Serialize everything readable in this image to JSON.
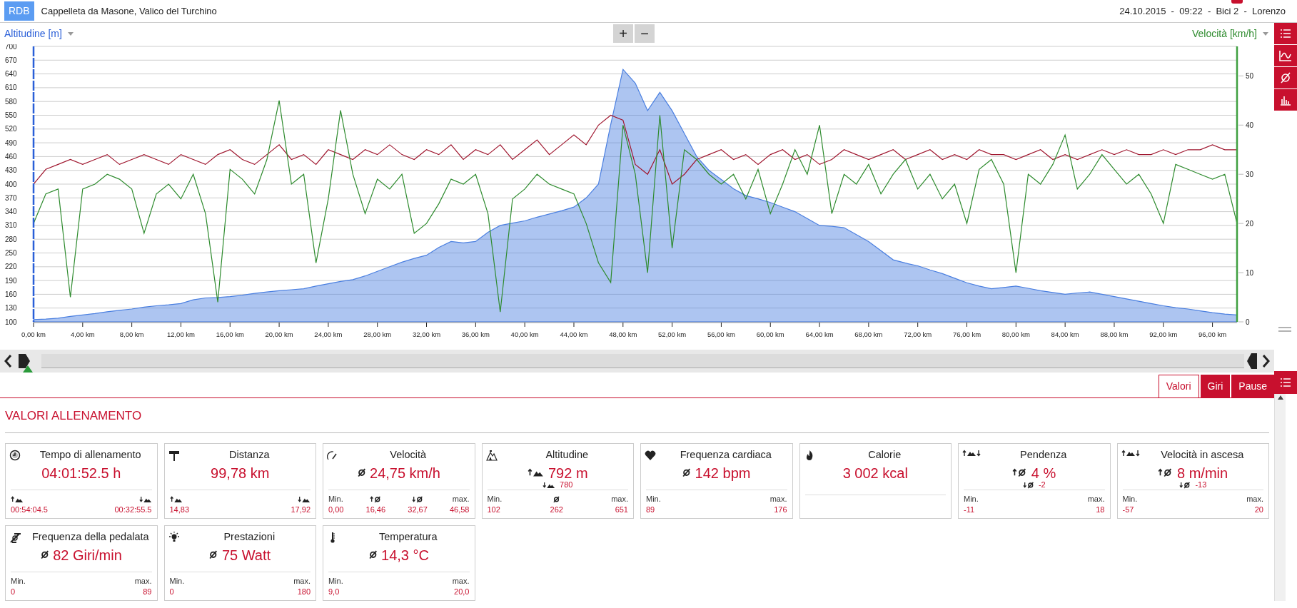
{
  "header": {
    "logo": "RDB",
    "title": "Cappelleta da Masone, Valico del Turchino",
    "info": "24.10.2015  -  09:22  -  Bici 2  -  Lorenzo"
  },
  "chart_toolbar": {
    "left_axis": "Altitudine [m]",
    "zoom_in": "+",
    "zoom_out": "−",
    "right_axis": "Velocità [km/h]"
  },
  "chart": {
    "chart_data": {
      "type": "area",
      "grid": true,
      "x": [
        0,
        1,
        2,
        3,
        4,
        5,
        6,
        7,
        8,
        9,
        10,
        11,
        12,
        13,
        14,
        15,
        16,
        17,
        18,
        19,
        20,
        21,
        22,
        23,
        24,
        25,
        26,
        27,
        28,
        29,
        30,
        31,
        32,
        33,
        34,
        35,
        36,
        37,
        38,
        39,
        40,
        41,
        42,
        43,
        44,
        45,
        46,
        47,
        48,
        49,
        50,
        51,
        52,
        53,
        54,
        55,
        56,
        57,
        58,
        59,
        60,
        61,
        62,
        63,
        64,
        65,
        66,
        67,
        68,
        69,
        70,
        71,
        72,
        73,
        74,
        75,
        76,
        77,
        78,
        79,
        80,
        81,
        82,
        83,
        84,
        85,
        86,
        87,
        88,
        89,
        90,
        91,
        92,
        93,
        94,
        95,
        96,
        97,
        98
      ],
      "series": [
        {
          "color": "#4a7fe0",
          "values": [
            105,
            106,
            108,
            112,
            115,
            118,
            122,
            125,
            128,
            132,
            135,
            137,
            140,
            148,
            152,
            153,
            155,
            158,
            162,
            165,
            168,
            170,
            172,
            178,
            183,
            188,
            192,
            200,
            210,
            220,
            230,
            238,
            245,
            262,
            275,
            272,
            275,
            295,
            310,
            315,
            320,
            328,
            335,
            342,
            350,
            370,
            400,
            530,
            650,
            620,
            560,
            600,
            560,
            510,
            460,
            430,
            410,
            390,
            375,
            368,
            360,
            350,
            340,
            325,
            310,
            308,
            305,
            290,
            275,
            255,
            235,
            228,
            222,
            213,
            205,
            195,
            185,
            178,
            172,
            175,
            178,
            173,
            168,
            164,
            160,
            163,
            165,
            160,
            155,
            150,
            145,
            140,
            135,
            131,
            128,
            124,
            120,
            117,
            115
          ]
        },
        {
          "type": "line",
          "axis": "y2",
          "color": "#a01830",
          "values": [
            28,
            31,
            32,
            33,
            32,
            33,
            34,
            32,
            33,
            34,
            33,
            32,
            34,
            33,
            32,
            34,
            35,
            33,
            32,
            34,
            36,
            33,
            34,
            32,
            35,
            34,
            33,
            35,
            34,
            36,
            34,
            33,
            35,
            34,
            36,
            33,
            35,
            34,
            36,
            33,
            35,
            37,
            34,
            36,
            38,
            36,
            40,
            42,
            41,
            32,
            30,
            35,
            28,
            30,
            33,
            34,
            35,
            33,
            34,
            32,
            34,
            35,
            33,
            34,
            32,
            33,
            35,
            34,
            33,
            34,
            35,
            33,
            34,
            35,
            33,
            34,
            33,
            35,
            34,
            34,
            33,
            34,
            35,
            33,
            34,
            33,
            34,
            35,
            34,
            35,
            34,
            34,
            35,
            34,
            35,
            35,
            36,
            35,
            35
          ]
        },
        {
          "type": "line",
          "axis": "y2",
          "color": "#2e8b2e",
          "values": [
            20,
            26,
            27,
            5,
            27,
            28,
            30,
            29,
            27,
            18,
            26,
            28,
            25,
            30,
            22,
            4,
            31,
            29,
            26,
            33,
            45,
            28,
            30,
            12,
            25,
            43,
            30,
            22,
            29,
            27,
            30,
            18,
            20,
            24,
            29,
            28,
            30,
            22,
            2,
            25,
            27,
            30,
            28,
            27,
            26,
            20,
            12,
            8,
            40,
            30,
            10,
            42,
            15,
            35,
            33,
            30,
            28,
            30,
            25,
            31,
            22,
            28,
            35,
            30,
            40,
            22,
            30,
            28,
            32,
            26,
            30,
            33,
            27,
            30,
            25,
            28,
            20,
            31,
            33,
            28,
            10,
            30,
            28,
            32,
            38,
            27,
            30,
            34,
            31,
            28,
            30,
            26,
            20,
            32,
            31,
            30,
            29,
            30,
            20
          ]
        }
      ],
      "xlim": [
        0,
        98
      ],
      "ylim": [
        100,
        700
      ],
      "y2lim": [
        0,
        56
      ],
      "xticks": [
        {
          "value": 0,
          "label": "0,00 km"
        },
        {
          "value": 4,
          "label": "4,00 km"
        },
        {
          "value": 8,
          "label": "8,00 km"
        },
        {
          "value": 12,
          "label": "12,00 km"
        },
        {
          "value": 16,
          "label": "16,00 km"
        },
        {
          "value": 20,
          "label": "20,00 km"
        },
        {
          "value": 24,
          "label": "24,00 km"
        },
        {
          "value": 28,
          "label": "28,00 km"
        },
        {
          "value": 32,
          "label": "32,00 km"
        },
        {
          "value": 36,
          "label": "36,00 km"
        },
        {
          "value": 40,
          "label": "40,00 km"
        },
        {
          "value": 44,
          "label": "44,00 km"
        },
        {
          "value": 48,
          "label": "48,00 km"
        },
        {
          "value": 52,
          "label": "52,00 km"
        },
        {
          "value": 56,
          "label": "56,00 km"
        },
        {
          "value": 60,
          "label": "60,00 km"
        },
        {
          "value": 64,
          "label": "64,00 km"
        },
        {
          "value": 68,
          "label": "68,00 km"
        },
        {
          "value": 72,
          "label": "72,00 km"
        },
        {
          "value": 76,
          "label": "76,00 km"
        },
        {
          "value": 80,
          "label": "80,00 km"
        },
        {
          "value": 84,
          "label": "84,00 km"
        },
        {
          "value": 88,
          "label": "88,00 km"
        },
        {
          "value": 92,
          "label": "92,00 km"
        },
        {
          "value": 96,
          "label": "96,00 km"
        }
      ],
      "yticks": [
        100,
        130,
        160,
        190,
        220,
        250,
        280,
        310,
        340,
        370,
        400,
        430,
        460,
        490,
        520,
        550,
        580,
        610,
        640,
        670,
        700
      ],
      "y2ticks": [
        0,
        10,
        20,
        30,
        40,
        50
      ]
    }
  },
  "tabs": [
    {
      "label": "Valori",
      "selected": true
    },
    {
      "label": "Giri",
      "selected": false
    },
    {
      "label": "Pause",
      "selected": false
    }
  ],
  "section_title": "VALORI ALLENAMENTO",
  "cards": [
    {
      "title": "Tempo di allenamento",
      "value": "04:01:52.5 h",
      "stats": [
        {
          "kind": "ascent",
          "value": "00:54:04.5"
        },
        {
          "kind": "descent",
          "value": "00:32:55.5"
        }
      ]
    },
    {
      "title": "Distanza",
      "value": "99,78 km",
      "stats": [
        {
          "kind": "ascent",
          "value": "14,83"
        },
        {
          "kind": "descent",
          "value": "17,92"
        }
      ]
    },
    {
      "kind": "average",
      "title": "Velocità",
      "value": "24,75 km/h",
      "stats": [
        {
          "label": "Min.",
          "value": "0,00"
        },
        {
          "kind": "up-average",
          "value": "16,46"
        },
        {
          "kind": "down-average",
          "value": "32,67"
        },
        {
          "label": "max.",
          "value": "46,58"
        }
      ]
    },
    {
      "kind": "ascent",
      "title": "Altitudine",
      "value": "792 m",
      "sub": {
        "kind": "descent",
        "text": "780"
      },
      "stats": [
        {
          "label": "Min.",
          "value": "102"
        },
        {
          "kind": "average",
          "value": "262"
        },
        {
          "label": "max.",
          "value": "651"
        }
      ]
    },
    {
      "kind": "average",
      "title": "Frequenza cardiaca",
      "value": "142 bpm",
      "stats": [
        {
          "label": "Min.",
          "value": "89"
        },
        {
          "label": "max.",
          "value": "176"
        }
      ]
    },
    {
      "title": "Calorie",
      "value": "3 002 kcal"
    },
    {
      "kind": "up-average",
      "title": "Pendenza",
      "value": "4 %",
      "sub": {
        "kind": "down-average",
        "text": "-2"
      },
      "stats": [
        {
          "label": "Min.",
          "value": "-11"
        },
        {
          "label": "max.",
          "value": "18"
        }
      ]
    },
    {
      "kind": "up-average",
      "title": "Velocità in ascesa",
      "value": "8 m/min",
      "sub": {
        "kind": "down-average",
        "text": "-13"
      },
      "stats": [
        {
          "label": "Min.",
          "value": "-57"
        },
        {
          "label": "max.",
          "value": "20"
        }
      ]
    },
    {
      "kind": "average",
      "title": "Frequenza della pedalata",
      "value": "82 Giri/min",
      "stats": [
        {
          "label": "Min.",
          "value": "0"
        },
        {
          "label": "max.",
          "value": "89"
        }
      ]
    },
    {
      "kind": "average",
      "title": "Prestazioni",
      "value": "75 Watt",
      "stats": [
        {
          "label": "Min.",
          "value": "0"
        },
        {
          "label": "max.",
          "value": "180"
        }
      ]
    },
    {
      "kind": "average",
      "title": "Temperatura",
      "value": "14,3 °C",
      "stats": [
        {
          "label": "Min.",
          "value": "9,0"
        },
        {
          "label": "max.",
          "value": "20,0"
        }
      ]
    }
  ]
}
